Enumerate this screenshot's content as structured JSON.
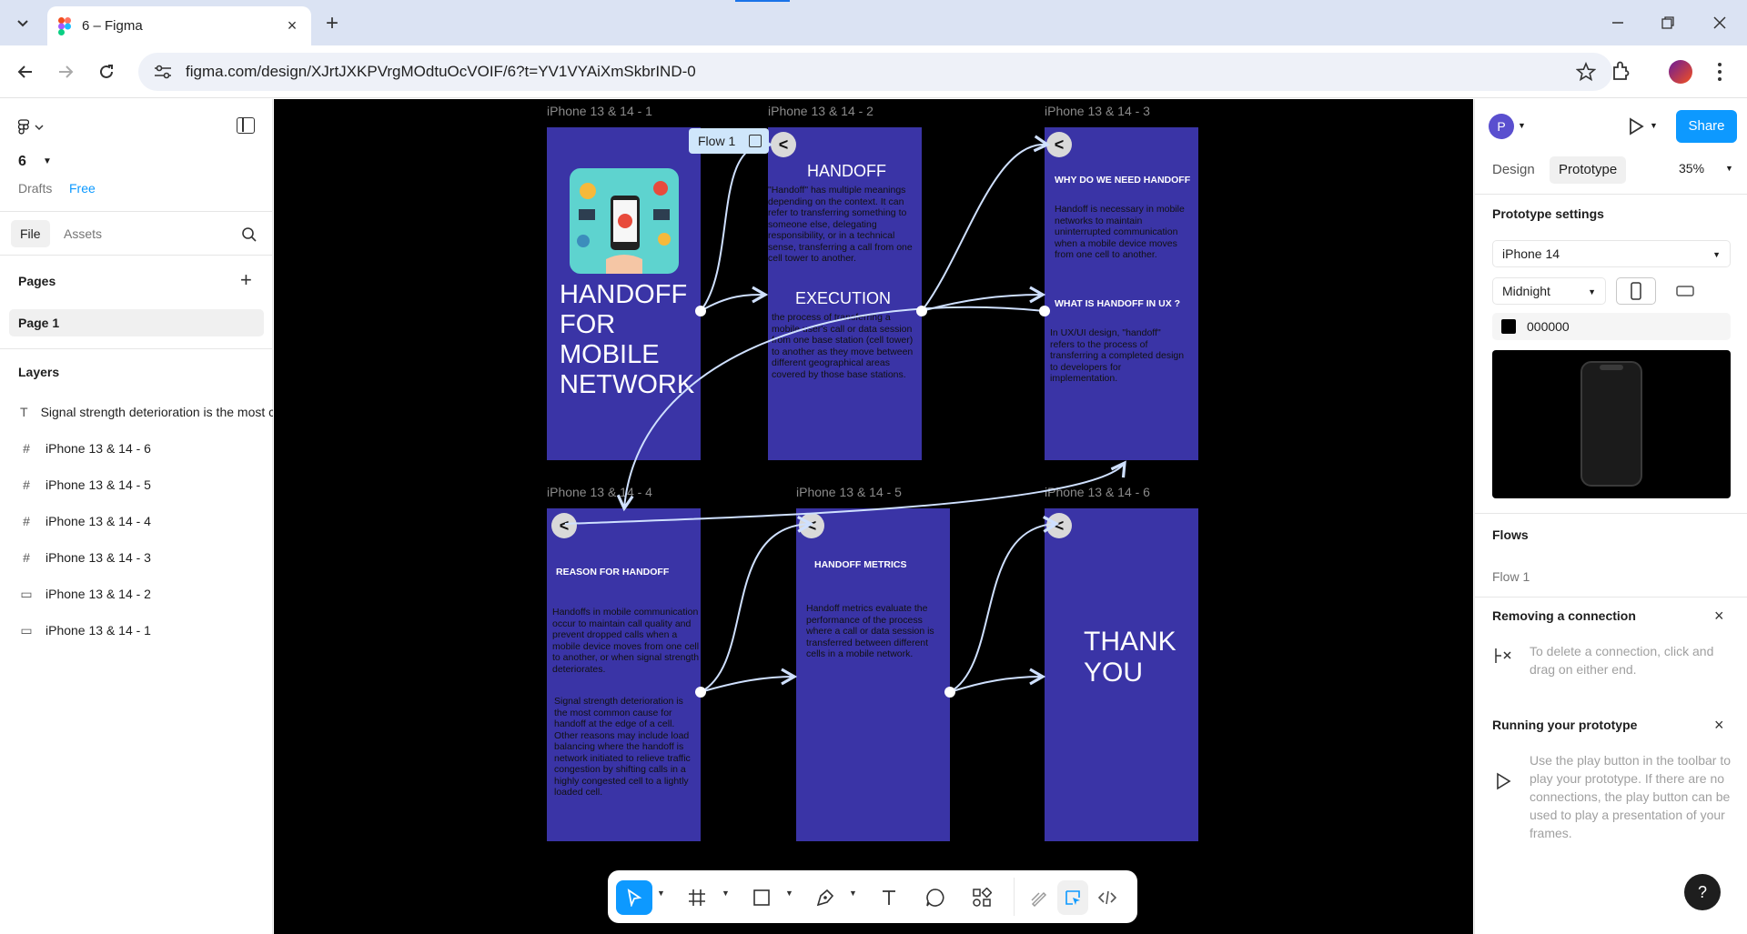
{
  "browser": {
    "tab_title": "6 – Figma",
    "url": "figma.com/design/XJrtJXKPVrgMOdtuOcVOIF/6?t=YV1VYAiXmSkbrIND-0"
  },
  "left_panel": {
    "file_name": "6",
    "location": "Drafts",
    "plan": "Free",
    "tabs": [
      "File",
      "Assets"
    ],
    "pages_title": "Pages",
    "pages": [
      "Page 1"
    ],
    "layers_title": "Layers",
    "layers": [
      {
        "icon": "text-icon",
        "name": "Signal strength deterioration is the most common cause for handoff at the edge of a cell."
      },
      {
        "icon": "frame-icon",
        "name": "iPhone 13 & 14 - 6"
      },
      {
        "icon": "frame-icon",
        "name": "iPhone 13 & 14 - 5"
      },
      {
        "icon": "frame-icon",
        "name": "iPhone 13 & 14 - 4"
      },
      {
        "icon": "frame-icon",
        "name": "iPhone 13 & 14 - 3"
      },
      {
        "icon": "rectangle-icon",
        "name": "iPhone 13 & 14 - 2"
      },
      {
        "icon": "rectangle-icon",
        "name": "iPhone 13 & 14 - 1"
      }
    ]
  },
  "canvas": {
    "flow_chip": "Flow 1",
    "frames": [
      {
        "label": "iPhone 13 & 14 - 1",
        "title": "HANDOFF FOR MOBILE NETWORK"
      },
      {
        "label": "iPhone 13 & 14 - 2",
        "heading1": "HANDOFF",
        "text1": "\"Handoff\" has multiple meanings depending on the context. It can refer to transferring something to someone else, delegating responsibility, or in a technical sense, transferring a call from one cell tower to another.",
        "heading2": "EXECUTION",
        "text2": "the process of transferring a mobile user's call or data session from one base station (cell tower) to another as they move between different geographical areas covered by those base stations."
      },
      {
        "label": "iPhone 13 & 14 - 3",
        "heading1": "WHY DO WE NEED HANDOFF",
        "text1": "Handoff is necessary in mobile networks to maintain uninterrupted communication when a mobile device moves from one cell to another.",
        "heading2": "WHAT IS HANDOFF IN UX ?",
        "text2": "In UX/UI design, \"handoff\" refers to the process of transferring a completed design to developers for implementation."
      },
      {
        "label": "iPhone 13 & 14 - 4",
        "heading1": "REASON FOR HANDOFF",
        "text1": "Handoffs in mobile communication occur to maintain call quality and prevent dropped calls when a mobile device moves from one cell to another, or when signal strength deteriorates.",
        "text2": "Signal strength deterioration is the most common cause for handoff at the edge of a cell. Other reasons may include load balancing where the handoff is network initiated to relieve traffic congestion by shifting calls in a highly congested cell to a lightly loaded cell."
      },
      {
        "label": "iPhone 13 & 14 - 5",
        "heading1": "HANDOFF METRICS",
        "text1": "Handoff metrics evaluate the performance of the process where a call or data session is transferred between different cells in a mobile network."
      },
      {
        "label": "iPhone 13 & 14 - 6",
        "title": "THANK YOU"
      }
    ],
    "back_glyph": "<",
    "frame_color": "#3a34a6",
    "connector_color": "#cfe0ff"
  },
  "toolbar_tools": [
    "move-tool",
    "frame-tool",
    "shape-tool",
    "pen-tool",
    "text-tool",
    "comment-tool",
    "actions-tool",
    "draw-mode",
    "design-mode",
    "dev-mode"
  ],
  "right_panel": {
    "avatar_letter": "P",
    "share_label": "Share",
    "tabs": [
      "Design",
      "Prototype"
    ],
    "zoom": "35%",
    "settings_title": "Prototype settings",
    "device": "iPhone 14",
    "device_color": "Midnight",
    "background_hex": "000000",
    "flows_title": "Flows",
    "flow_name": "Flow 1",
    "removing_title": "Removing a connection",
    "removing_text": "To delete a connection, click and drag on either end.",
    "running_title": "Running your prototype",
    "running_text": "Use the play button in the toolbar to play your prototype. If there are no connections, the play button can be used to play a presentation of your frames.",
    "help_label": "?",
    "accent_color": "#0d99ff"
  }
}
